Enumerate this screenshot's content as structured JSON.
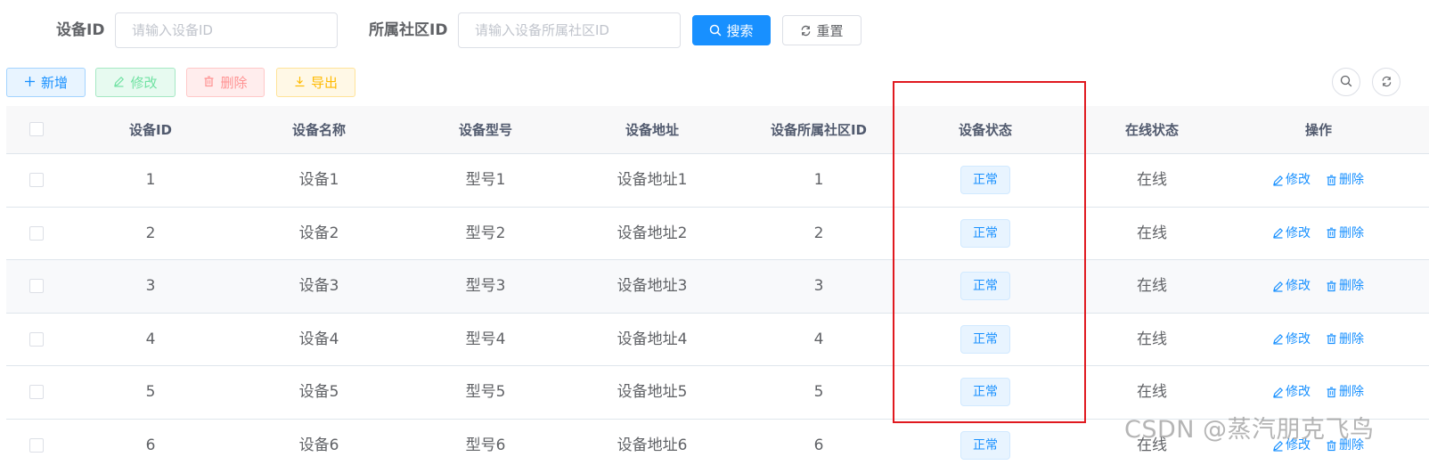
{
  "search": {
    "device_id_label": "设备ID",
    "device_id_placeholder": "请输入设备ID",
    "community_label": "所属社区ID",
    "community_placeholder": "请输入设备所属社区ID",
    "search_button": "搜索",
    "reset_button": "重置"
  },
  "toolbar": {
    "add": "新增",
    "edit": "修改",
    "delete": "删除",
    "export": "导出"
  },
  "table": {
    "headers": {
      "id": "设备ID",
      "name": "设备名称",
      "model": "设备型号",
      "address": "设备地址",
      "community": "设备所属社区ID",
      "status": "设备状态",
      "online": "在线状态",
      "actions": "操作"
    },
    "action_edit": "修改",
    "action_delete": "删除",
    "rows": [
      {
        "id": "1",
        "name": "设备1",
        "model": "型号1",
        "address": "设备地址1",
        "community": "1",
        "status": "正常",
        "online": "在线"
      },
      {
        "id": "2",
        "name": "设备2",
        "model": "型号2",
        "address": "设备地址2",
        "community": "2",
        "status": "正常",
        "online": "在线"
      },
      {
        "id": "3",
        "name": "设备3",
        "model": "型号3",
        "address": "设备地址3",
        "community": "3",
        "status": "正常",
        "online": "在线"
      },
      {
        "id": "4",
        "name": "设备4",
        "model": "型号4",
        "address": "设备地址4",
        "community": "4",
        "status": "正常",
        "online": "在线"
      },
      {
        "id": "5",
        "name": "设备5",
        "model": "型号5",
        "address": "设备地址5",
        "community": "5",
        "status": "正常",
        "online": "在线"
      },
      {
        "id": "6",
        "name": "设备6",
        "model": "型号6",
        "address": "设备地址6",
        "community": "6",
        "status": "正常",
        "online": "在线"
      }
    ]
  },
  "watermark": "CSDN @蒸汽朋克飞鸟",
  "colors": {
    "primary": "#1890ff",
    "highlight": "#e0191f"
  },
  "icons": {
    "search": "search-icon",
    "reset": "refresh-icon",
    "add": "plus-icon",
    "edit": "edit-icon",
    "delete": "trash-icon",
    "export": "download-icon"
  }
}
